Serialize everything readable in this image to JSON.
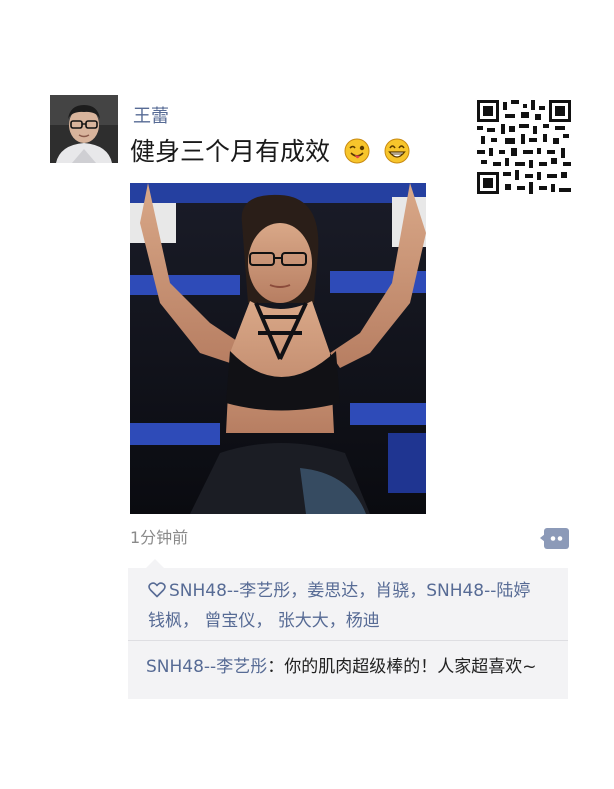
{
  "post": {
    "author": "王蕾",
    "text": "健身三个月有成效",
    "emojis": [
      "tongue-wink-emoji",
      "grinning-emoji"
    ],
    "time": "1分钟前"
  },
  "likes": {
    "icon": "heart-outline-icon",
    "line1": "SNH48--李艺彤，姜思达，肖骁，SNH48--陆婷",
    "line2": "钱枫， 曾宝仪， 张大大，杨迪"
  },
  "comments": [
    {
      "author": "SNH48--李艺彤",
      "separator": "：",
      "text": "你的肌肉超级棒的！人家超喜欢~"
    }
  ],
  "colors": {
    "link": "#576b95",
    "timestamp": "#8a8a8a",
    "panel_bg": "#f3f3f5",
    "comment_button": "#8c9ab8"
  }
}
